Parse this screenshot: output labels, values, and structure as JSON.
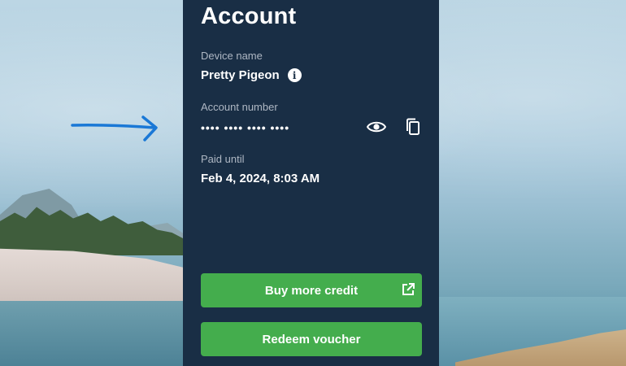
{
  "panel": {
    "title": "Account",
    "device": {
      "label": "Device name",
      "value": "Pretty Pigeon",
      "icon": "info-icon"
    },
    "account_number": {
      "label": "Account number",
      "value": "•••• •••• •••• ••••",
      "show_icon": "eye-icon",
      "copy_icon": "copy-icon"
    },
    "paid_until": {
      "label": "Paid until",
      "value": "Feb 4, 2024, 8:03 AM"
    },
    "buttons": {
      "buy_credit": "Buy more credit",
      "redeem_voucher": "Redeem voucher"
    }
  },
  "colors": {
    "panel_bg": "#192e45",
    "button_green": "#44ad4d",
    "annotation_arrow": "#1a78d6"
  }
}
